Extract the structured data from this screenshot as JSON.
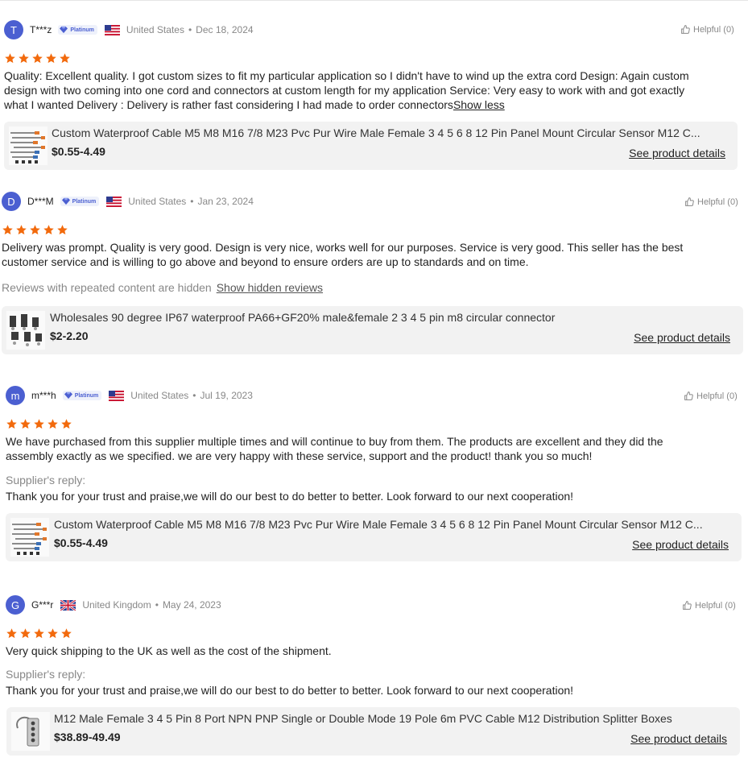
{
  "helpful_label": "Helpful (0)",
  "colors": {
    "star": "#f26a0d",
    "avatar": "#4b5fd1",
    "badge": "#4b5fd1",
    "card": "#f2f2f2"
  },
  "reviews": [
    {
      "avatar": "T",
      "user": "T***z",
      "badge": "Platinum",
      "flag_icon": "us-flag-icon",
      "country": "United States",
      "date": "Dec 18, 2024",
      "rating": 5,
      "text_lines": [
        "Quality: Excellent quality.  I got custom sizes to fit my particular application so I didn't have to wind up the extra cord Design: Again custom",
        "design with two coming into one cord and connectors at custom length for my application Service: Very easy to work with and got exactly",
        "what I wanted Delivery : Delivery is rather fast considering I had made to order connectors"
      ],
      "toggle": "Show less",
      "product": {
        "title": "Custom Waterproof Cable M5 M8 M16 7/8 M23 Pvc Pur Wire Male Female 3 4 5 6 8 12 Pin Panel Mount Circular Sensor M12 C...",
        "price": "$0.55-4.49",
        "details": "See product details"
      }
    },
    {
      "avatar": "D",
      "user": "D***M",
      "badge": "Platinum",
      "flag_icon": "us-flag-icon",
      "country": "United States",
      "date": "Jan 23, 2024",
      "rating": 5,
      "text_lines": [
        "Delivery was prompt. Quality is very good. Design is very nice, works well for our purposes. Service is very good. This seller has the best",
        "customer service and is willing to go above and beyond to ensure orders are up to standards and on time."
      ],
      "hidden_note": "Reviews with repeated content are hidden",
      "hidden_link": "Show hidden reviews",
      "product": {
        "title": "Wholesales 90 degree IP67 waterproof PA66+GF20% male&female 2 3 4 5 pin m8 circular connector",
        "price": "$2-2.20",
        "details": "See product details"
      }
    },
    {
      "avatar": "m",
      "user": "m***h",
      "badge": "Platinum",
      "flag_icon": "us-flag-icon",
      "country": "United States",
      "date": "Jul 19, 2023",
      "rating": 5,
      "text_lines": [
        "We have purchased from this supplier multiple times and will continue to buy from them. The products are excellent and they did the",
        "assembly exactly as we specified. we are very happy with these service, support and the product! thank you so much!"
      ],
      "reply_label": "Supplier's reply:",
      "reply_text": "Thank you for your trust and praise,we will do our best to do better to better. Look forward to our next cooperation!",
      "product": {
        "title": "Custom Waterproof Cable M5 M8 M16 7/8 M23 Pvc Pur Wire Male Female 3 4 5 6 8 12 Pin Panel Mount Circular Sensor M12 C...",
        "price": "$0.55-4.49",
        "details": "See product details"
      }
    },
    {
      "avatar": "G",
      "user": "G***r",
      "flag_icon": "uk-flag-icon",
      "country": "United Kingdom",
      "date": "May 24, 2023",
      "rating": 5,
      "text_lines": [
        "Very quick shipping to the UK as well as the cost of the shipment."
      ],
      "reply_label": "Supplier's reply:",
      "reply_text": "Thank you for your trust and praise,we will do our best to do better to better. Look forward to our next cooperation!",
      "product": {
        "title": "M12 Male Female 3 4 5 Pin 8 Port NPN PNP Single or Double Mode 19 Pole 6m PVC Cable M12 Distribution Splitter Boxes",
        "price": "$38.89-49.49",
        "details": "See product details"
      }
    }
  ]
}
